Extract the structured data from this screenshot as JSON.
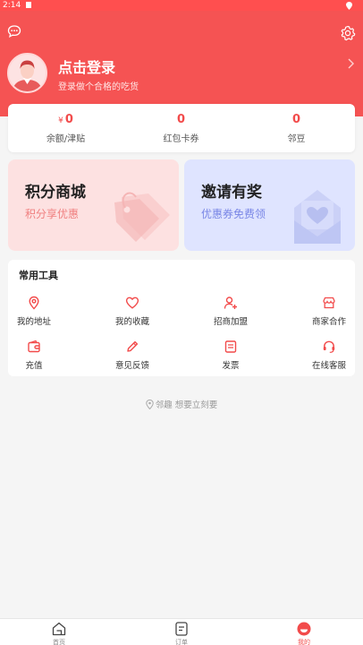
{
  "status_bar": {
    "time": "2:14"
  },
  "header": {
    "login_title": "点击登录",
    "login_subtitle": "登录做个合格的吃货"
  },
  "wallet": {
    "items": [
      {
        "currency": "¥",
        "value": "0",
        "label": "余额/津贴"
      },
      {
        "currency": "",
        "value": "0",
        "label": "红包卡券"
      },
      {
        "currency": "",
        "value": "0",
        "label": "邻豆"
      }
    ]
  },
  "promos": {
    "points_mall": {
      "title": "积分商城",
      "subtitle": "积分享优惠"
    },
    "invite": {
      "title": "邀请有奖",
      "subtitle": "优惠券免费领"
    }
  },
  "tools": {
    "title": "常用工具",
    "items": [
      {
        "label": "我的地址",
        "icon": "location-icon"
      },
      {
        "label": "我的收藏",
        "icon": "heart-icon"
      },
      {
        "label": "招商加盟",
        "icon": "user-add-icon"
      },
      {
        "label": "商家合作",
        "icon": "store-icon"
      },
      {
        "label": "充值",
        "icon": "wallet-icon"
      },
      {
        "label": "意见反馈",
        "icon": "pencil-icon"
      },
      {
        "label": "发票",
        "icon": "receipt-icon"
      },
      {
        "label": "在线客服",
        "icon": "headset-icon"
      }
    ]
  },
  "slogan": "邻趣 想要立刻要",
  "tabbar": {
    "items": [
      {
        "label": "首页",
        "icon": "home-icon"
      },
      {
        "label": "订单",
        "icon": "order-icon"
      },
      {
        "label": "我的",
        "icon": "profile-icon"
      }
    ],
    "active": "我的"
  },
  "colors": {
    "accent": "#f55353",
    "price": "#f24b4b",
    "promo_left_bg": "#fde1e1",
    "promo_right_bg": "#dfe4ff"
  }
}
